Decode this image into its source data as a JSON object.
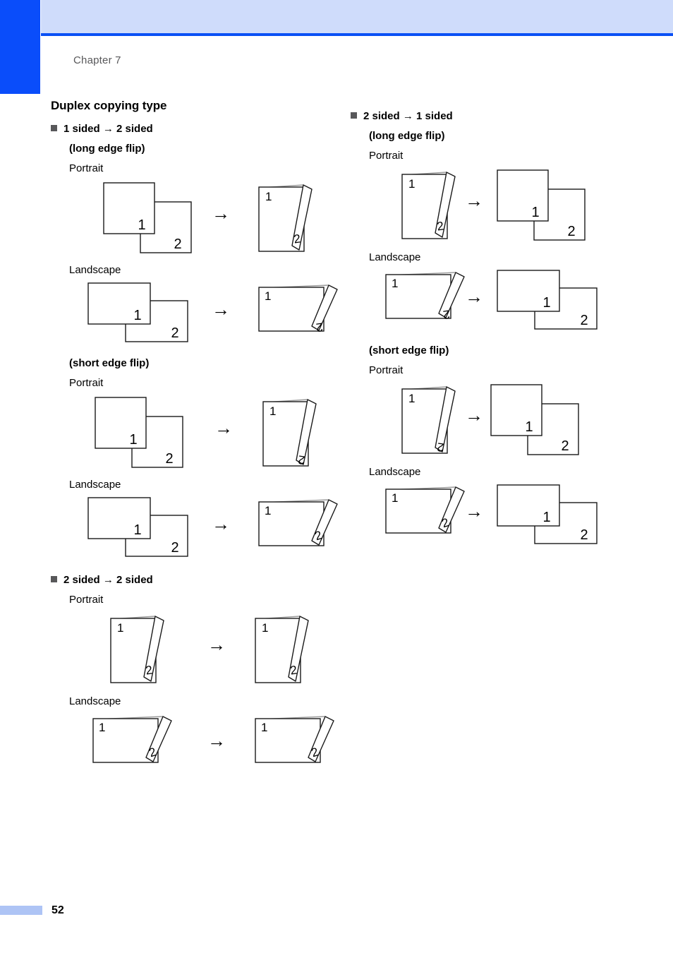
{
  "header": {
    "chapter_label": "Chapter 7",
    "band_color": "#cfdcfb",
    "rule_color": "#0a50f5",
    "tab_color": "#0a4dfa"
  },
  "footer": {
    "page_number": "52",
    "bar_color": "#aec4f5"
  },
  "page": {
    "section_title": "Duplex copying type"
  },
  "labels": {
    "portrait": "Portrait",
    "landscape": "Landscape",
    "long_edge_flip": "(long edge flip)",
    "short_edge_flip": "(short edge flip)",
    "one_to_two": "1 sided → 2 sided",
    "two_to_two": "2 sided → 2 sided",
    "two_to_one": "2 sided → 1 sided",
    "arrow": "→",
    "page_num_1": "1",
    "page_num_2": "2"
  },
  "left_column": {
    "group1": {
      "heading": "1 sided → 2 sided",
      "flip_long": "(long edge flip)",
      "flip_short": "(short edge flip)",
      "orient_portrait": "Portrait",
      "orient_landscape": "Landscape"
    },
    "group2": {
      "heading": "2 sided → 2 sided",
      "orient_portrait": "Portrait",
      "orient_landscape": "Landscape"
    }
  },
  "right_column": {
    "group1": {
      "heading": "2 sided → 1 sided",
      "flip_long": "(long edge flip)",
      "flip_short": "(short edge flip)",
      "orient_portrait": "Portrait",
      "orient_landscape": "Landscape"
    }
  },
  "diagrams": [
    {
      "id": "l1",
      "section": "1 sided to 2 sided",
      "flip": "long edge flip",
      "orientation": "Portrait",
      "from": "two-simplex-portrait",
      "to": "duplex-portrait",
      "back_page_rotation": "upright"
    },
    {
      "id": "l2",
      "section": "1 sided to 2 sided",
      "flip": "long edge flip",
      "orientation": "Landscape",
      "from": "two-simplex-landscape",
      "to": "duplex-landscape",
      "back_page_rotation": "inverted"
    },
    {
      "id": "l3",
      "section": "1 sided to 2 sided",
      "flip": "short edge flip",
      "orientation": "Portrait",
      "from": "two-simplex-portrait",
      "to": "duplex-portrait",
      "back_page_rotation": "inverted"
    },
    {
      "id": "l4",
      "section": "1 sided to 2 sided",
      "flip": "short edge flip",
      "orientation": "Landscape",
      "from": "two-simplex-landscape",
      "to": "duplex-landscape",
      "back_page_rotation": "upright"
    },
    {
      "id": "l5",
      "section": "2 sided to 2 sided",
      "flip": "",
      "orientation": "Portrait",
      "from": "duplex-portrait",
      "to": "duplex-portrait",
      "back_page_rotation": "upright"
    },
    {
      "id": "l6",
      "section": "2 sided to 2 sided",
      "flip": "",
      "orientation": "Landscape",
      "from": "duplex-landscape",
      "to": "duplex-landscape",
      "back_page_rotation": "upright"
    },
    {
      "id": "r1",
      "section": "2 sided to 1 sided",
      "flip": "long edge flip",
      "orientation": "Portrait",
      "from": "duplex-portrait",
      "to": "two-simplex-portrait",
      "back_page_rotation": "upright"
    },
    {
      "id": "r2",
      "section": "2 sided to 1 sided",
      "flip": "long edge flip",
      "orientation": "Landscape",
      "from": "duplex-landscape",
      "to": "two-simplex-landscape",
      "back_page_rotation": "inverted"
    },
    {
      "id": "r3",
      "section": "2 sided to 1 sided",
      "flip": "short edge flip",
      "orientation": "Portrait",
      "from": "duplex-portrait",
      "to": "two-simplex-portrait",
      "back_page_rotation": "inverted"
    },
    {
      "id": "r4",
      "section": "2 sided to 1 sided",
      "flip": "short edge flip",
      "orientation": "Landscape",
      "from": "duplex-landscape",
      "to": "two-simplex-landscape",
      "back_page_rotation": "upright"
    }
  ]
}
